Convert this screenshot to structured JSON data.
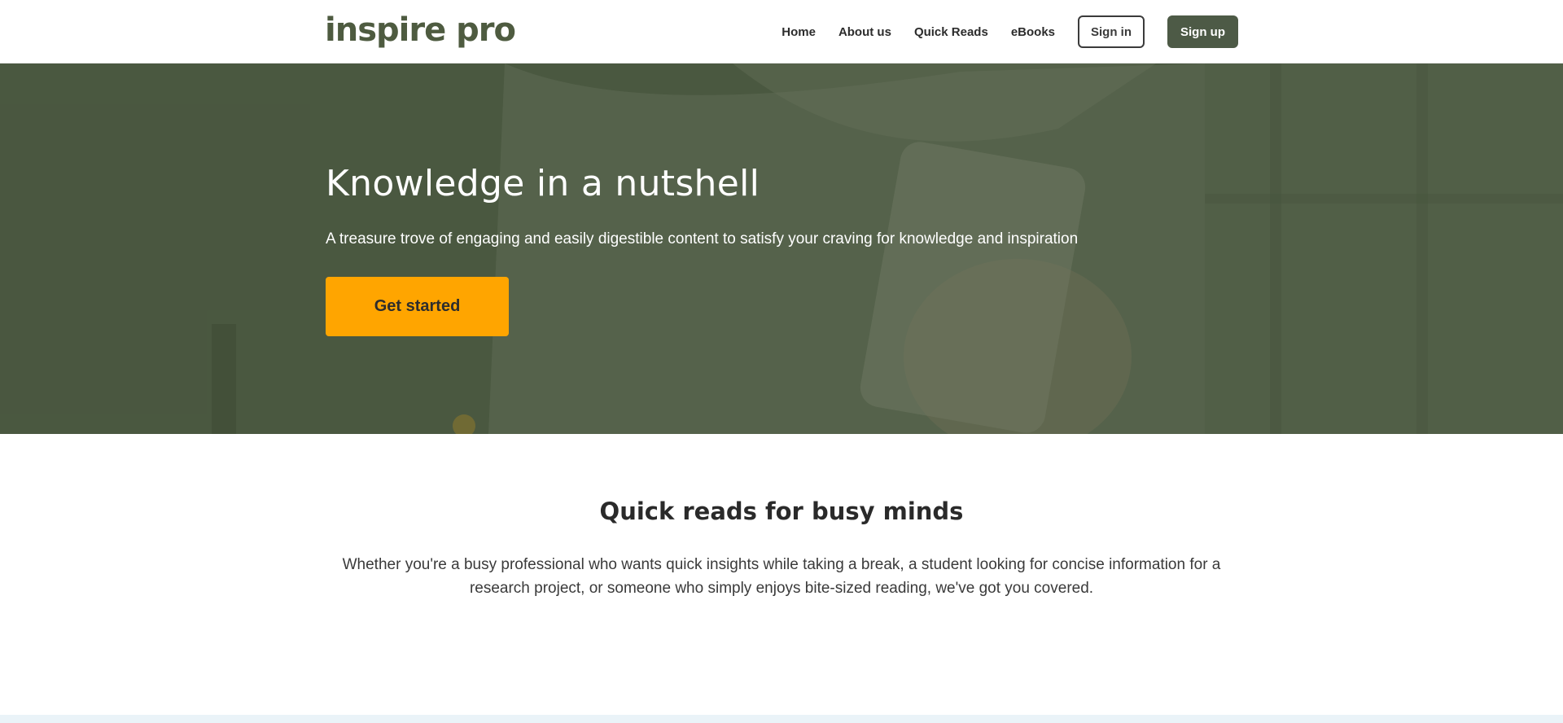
{
  "header": {
    "logo_text": "inspire pro",
    "nav": [
      "Home",
      "About us",
      "Quick Reads",
      "eBooks"
    ],
    "signin_label": "Sign in",
    "signup_label": "Sign up"
  },
  "hero": {
    "title": "Knowledge in a nutshell",
    "subtitle": "A treasure trove of engaging and easily digestible content to satisfy your craving for knowledge and inspiration",
    "cta_label": "Get started"
  },
  "quick_reads": {
    "title": "Quick reads for busy minds",
    "body": "Whether you're a busy professional who wants quick insights while taking a break, a student looking for concise information for a research project, or someone who simply enjoys bite-sized reading, we've got you covered."
  },
  "colors": {
    "brand": "#4e5b40",
    "accent": "#ffa500",
    "signup_bg": "#4d5a46"
  }
}
